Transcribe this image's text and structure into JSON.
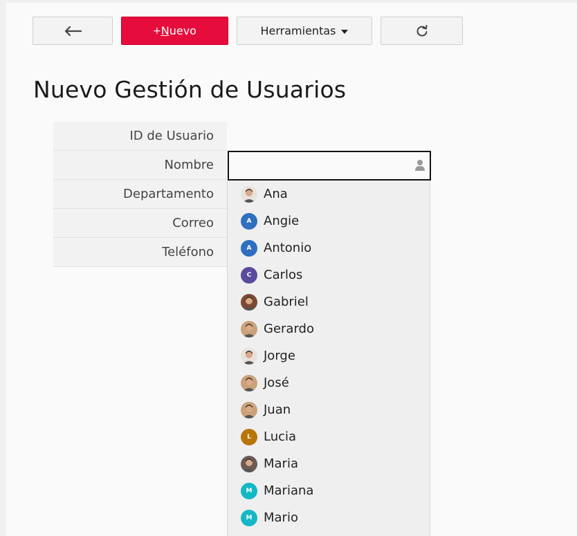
{
  "toolbar": {
    "back_glyph": "←",
    "new_prefix": "+",
    "new_first_letter": "N",
    "new_rest": "uevo",
    "tools_label": "Herramientas",
    "refresh_glyph": "↻"
  },
  "page": {
    "title": "Nuevo Gestión de Usuarios"
  },
  "form": {
    "fields": [
      {
        "label": "ID de Usuario"
      },
      {
        "label": "Nombre"
      },
      {
        "label": "Departamento"
      },
      {
        "label": "Correo"
      },
      {
        "label": "Teléfono"
      }
    ],
    "name_value": ""
  },
  "dropdown": {
    "items": [
      {
        "name": "Ana",
        "avatar": "photo",
        "color": "#e9e2dc"
      },
      {
        "name": "Angie",
        "avatar": "A",
        "color": "#2f6fbf"
      },
      {
        "name": "Antonio",
        "avatar": "A",
        "color": "#2f6fbf"
      },
      {
        "name": "Carlos",
        "avatar": "C",
        "color": "#5b4b9a"
      },
      {
        "name": "Gabriel",
        "avatar": "photo",
        "color": "#7a4a32"
      },
      {
        "name": "Gerardo",
        "avatar": "photo",
        "color": "#c9a27a"
      },
      {
        "name": "Jorge",
        "avatar": "photo",
        "color": "#e9e2dc"
      },
      {
        "name": "José",
        "avatar": "photo",
        "color": "#c9a27a"
      },
      {
        "name": "Juan",
        "avatar": "photo",
        "color": "#c9a27a"
      },
      {
        "name": "Lucia",
        "avatar": "L",
        "color": "#b8760a"
      },
      {
        "name": "Maria",
        "avatar": "photo",
        "color": "#6b5a55"
      },
      {
        "name": "Mariana",
        "avatar": "M",
        "color": "#14b8c4"
      },
      {
        "name": "Mario",
        "avatar": "M",
        "color": "#14b8c4"
      }
    ]
  }
}
